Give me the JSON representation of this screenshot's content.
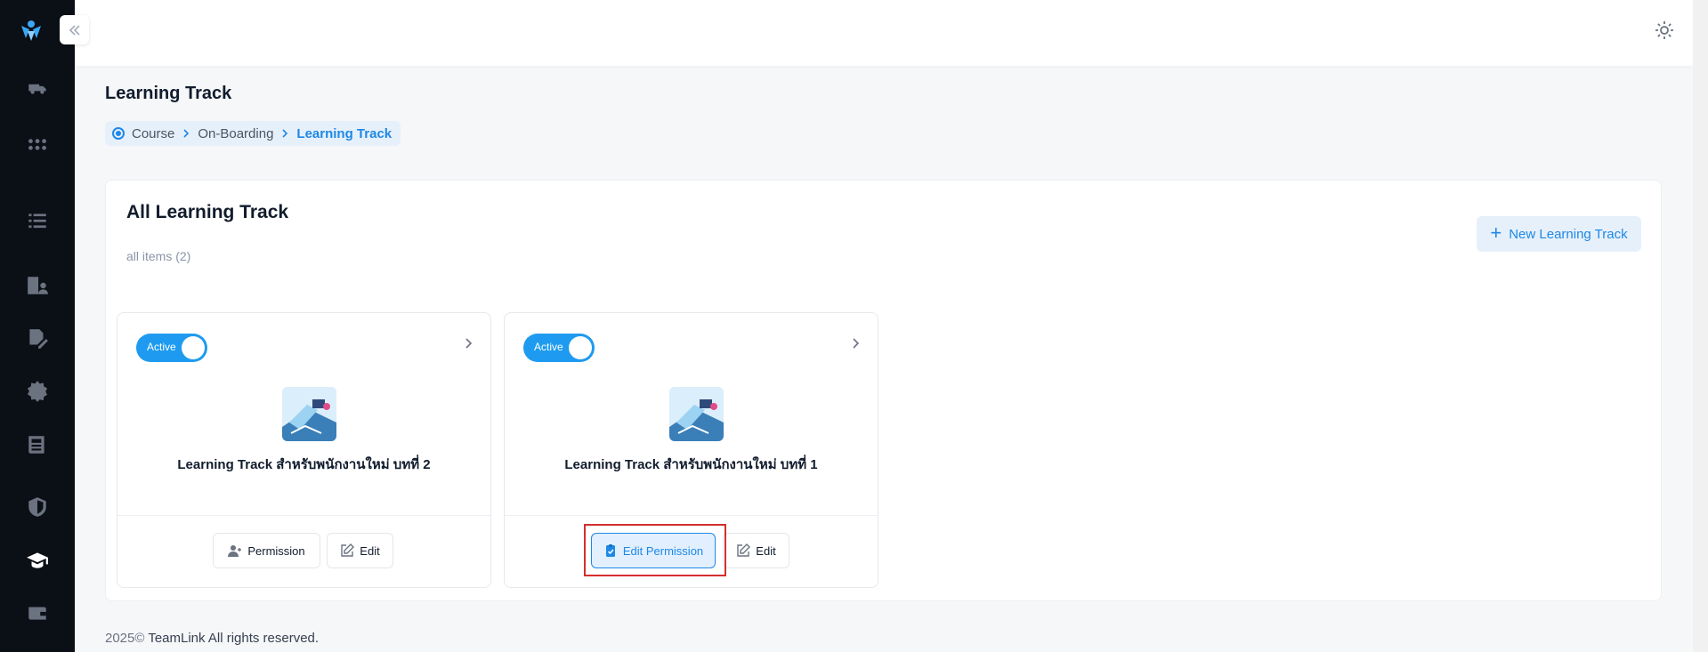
{
  "header": {
    "sun_icon": "sun-icon",
    "avatar": "user-avatar"
  },
  "sidebar": {
    "icons": [
      "truck-icon",
      "apps-grid-icon",
      "list-icon",
      "building-user-icon",
      "edit-document-icon",
      "badge-icon",
      "newspaper-icon",
      "shield-icon",
      "graduation-cap-icon",
      "wallet-icon"
    ],
    "active": "graduation-cap-icon"
  },
  "page": {
    "title": "Learning Track",
    "breadcrumb": [
      "Course",
      "On-Boarding",
      "Learning Track"
    ]
  },
  "card": {
    "title": "All Learning Track",
    "subtitle": "all items (2)",
    "new_button": "New Learning Track",
    "tracks": [
      {
        "status": "Active",
        "name": "Learning Track สำหรับพนักงานใหม่ บทที่ 2",
        "button_primary": "Permission",
        "button_edit": "Edit"
      },
      {
        "status": "Active",
        "name": "Learning Track สำหรับพนักงานใหม่ บทที่ 1",
        "button_primary": "Edit Permission",
        "button_edit": "Edit"
      }
    ]
  },
  "footer": {
    "year": "2025©",
    "text": " TeamLink All rights reserved."
  },
  "colors": {
    "accent": "#1e88e5",
    "sidebar": "#0b0f16",
    "highlight": "#d32f2f"
  }
}
